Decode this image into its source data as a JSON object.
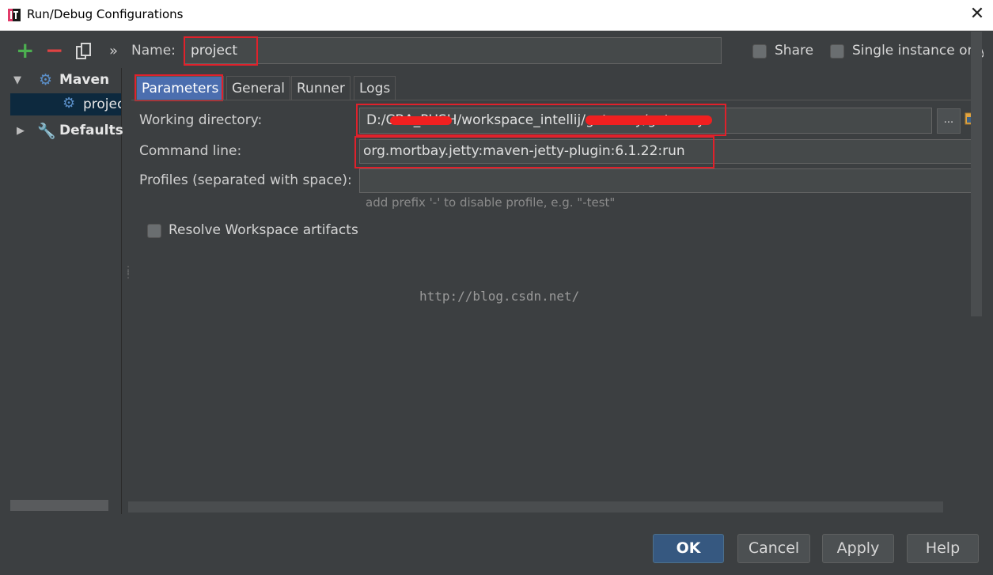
{
  "window": {
    "title": "Run/Debug Configurations",
    "close_glyph": "✕"
  },
  "toolbar": {
    "add": "+",
    "remove": "−",
    "more": "»"
  },
  "name_row": {
    "label": "Name:",
    "value": "project"
  },
  "share": {
    "label": "Share"
  },
  "single_instance": {
    "label": "Single instance only"
  },
  "sidebar": {
    "maven": "Maven",
    "project_item": "project",
    "defaults": "Defaults"
  },
  "tabs": [
    "Parameters",
    "General",
    "Runner",
    "Logs"
  ],
  "params": {
    "workdir_label": "Working directory:",
    "workdir_value": "D:/CBA_PUSH/workspace_intellij/gateway/gateway",
    "browse": "...",
    "cmd_label": "Command line:",
    "cmd_value": "org.mortbay.jetty:maven-jetty-plugin:6.1.22:run",
    "profiles_label": "Profiles (separated with space):",
    "profiles_value": "",
    "profiles_hint": "add prefix '-' to disable profile, e.g. \"-test\"",
    "resolve_label": "Resolve Workspace artifacts"
  },
  "watermark": "http://blog.csdn.net/",
  "buttons": {
    "ok": "OK",
    "cancel": "Cancel",
    "apply": "Apply",
    "help": "Help"
  },
  "colors": {
    "accent": "#4b6eaf",
    "highlight_box": "#e0212b",
    "background": "#3c3f41"
  }
}
